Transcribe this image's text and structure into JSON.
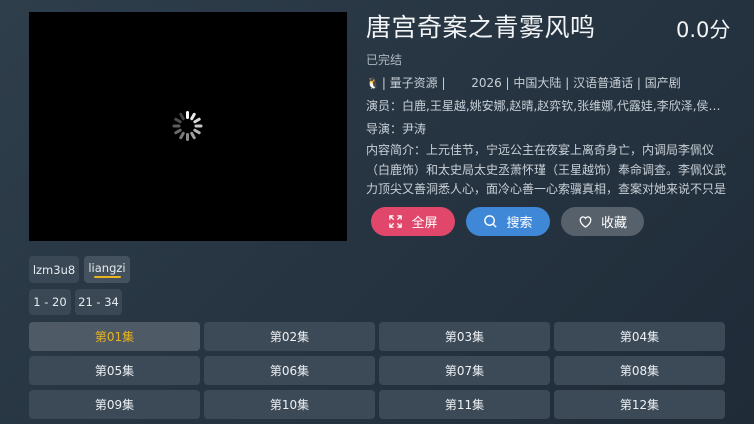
{
  "video": {
    "title": "唐宫奇案之青雾风鸣",
    "score": "0.0分",
    "status": "已完结",
    "source_icon": "🐧",
    "source": "| 量子资源 |",
    "info": "2026 | 中国大陆 | 汉语普通话 | 国产剧",
    "cast": "演员：白鹿,王星越,姚安娜,赵晴,赵弈钦,张维娜,代露娃,李欣泽,侯长荣...",
    "director": "导演：尹涛",
    "synopsis": "内容简介：上元佳节，宁远公主在夜宴上离奇身亡，内调局李佩仪（白鹿饰）和太史局太史丞萧怀瑾（王星越饰）奉命调查。李佩仪武力顶尖又善洞悉人心，面冷心善一心索骥真相，查案对她来说不只是探究真..."
  },
  "actions": {
    "fullscreen": "全屏",
    "search": "搜索",
    "favorite": "收藏"
  },
  "sources": [
    {
      "label": "lzm3u8"
    },
    {
      "label": "liangzi"
    }
  ],
  "ranges": [
    "1 - 20",
    "21 - 34"
  ],
  "episodes": [
    "第01集",
    "第02集",
    "第03集",
    "第04集",
    "第05集",
    "第06集",
    "第07集",
    "第08集",
    "第09集",
    "第10集",
    "第11集",
    "第12集"
  ],
  "colors": {
    "accent_yellow": "#e9b41f",
    "fullscreen_btn": "#e0476b",
    "search_btn": "#3f88d8",
    "favorite_btn": "#56616c"
  }
}
